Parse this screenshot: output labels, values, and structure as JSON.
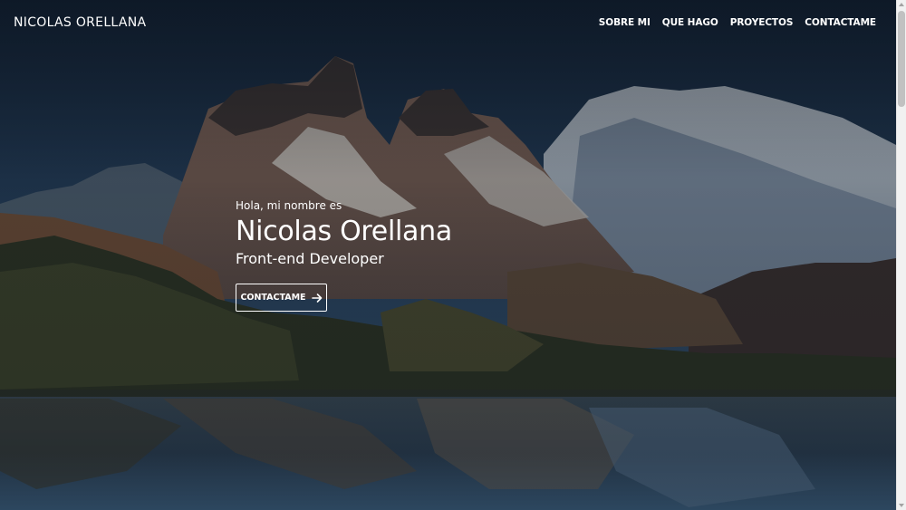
{
  "navbar": {
    "brand": "NICOLAS ORELLANA",
    "links": [
      {
        "label": "SOBRE MI"
      },
      {
        "label": "QUE HAGO"
      },
      {
        "label": "PROYECTOS"
      },
      {
        "label": "CONTACTAME"
      }
    ]
  },
  "hero": {
    "greeting": "Hola, mi nombre es",
    "name": "Nicolas Orellana",
    "role": "Front-end Developer",
    "cta": {
      "label": "CONTACTAME",
      "icon": "arrow-right-icon"
    },
    "background": "mountain-lake-photo"
  },
  "colors": {
    "text": "#ffffff",
    "overlay": "#0a121c"
  }
}
